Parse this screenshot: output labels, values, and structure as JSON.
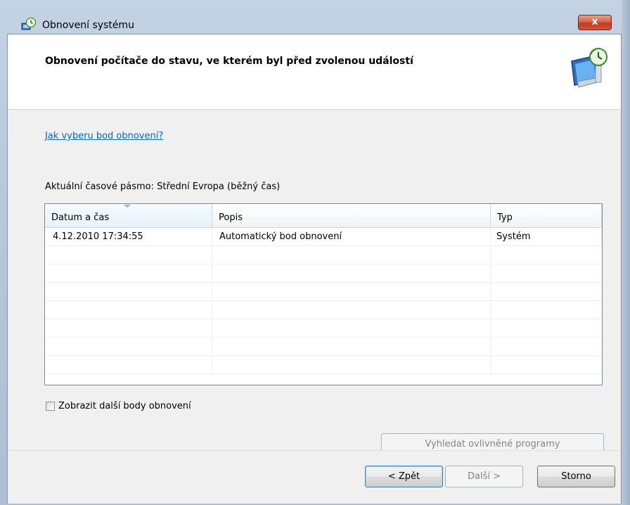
{
  "window": {
    "title": "Obnovení systému",
    "close_label": "x"
  },
  "header": {
    "title": "Obnovení počítače do stavu, ve kterém byl před zvolenou událostí",
    "icon": "system-restore-monitor-icon"
  },
  "content": {
    "help_link": "Jak vyberu bod obnovení?",
    "timezone": "Aktuální časové pásmo: Střední Evropa (běžný čas)",
    "table": {
      "columns": [
        "Datum a čas",
        "Popis",
        "Typ"
      ],
      "rows": [
        [
          "4.12.2010 17:34:55",
          "Automatický bod obnovení",
          "Systém"
        ]
      ]
    },
    "show_more_checkbox": {
      "label": "Zobrazit další body obnovení",
      "checked": false
    },
    "scan_button": "Vyhledat ovlivněné programy"
  },
  "footer": {
    "back": "< Zpět",
    "next": "Další >",
    "cancel": "Storno"
  },
  "colors": {
    "link": "#0066cc",
    "close_button": "#c23a1f",
    "frame": "#b7c8da"
  }
}
